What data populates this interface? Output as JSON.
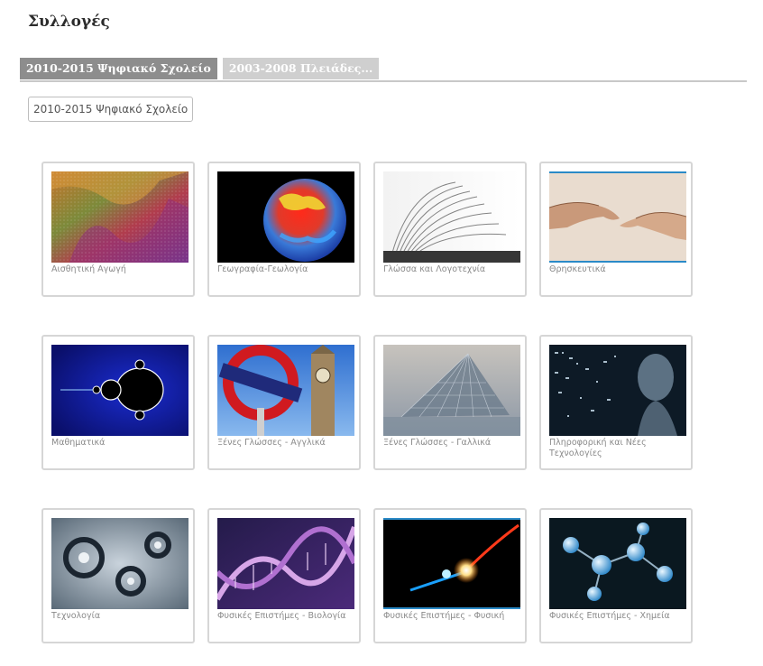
{
  "page": {
    "title": "Συλλογές"
  },
  "tabs": [
    {
      "label": "2010-2015 Ψηφιακό Σχολείο",
      "active": true
    },
    {
      "label": "2003-2008 Πλειάδες...",
      "active": false
    }
  ],
  "sub_button": {
    "label": "2010-2015 Ψηφιακό Σχολείο"
  },
  "collections": [
    {
      "label": "Αισθητική Αγωγή",
      "thumbnail": "abstract-painting"
    },
    {
      "label": "Γεωγραφία-Γεωλογία",
      "thumbnail": "earth-globe"
    },
    {
      "label": "Γλώσσα και Λογοτεχνία",
      "thumbnail": "open-book"
    },
    {
      "label": "Θρησκευτικά",
      "thumbnail": "creation-hands"
    },
    {
      "label": "Μαθηματικά",
      "thumbnail": "mandelbrot-fractal"
    },
    {
      "label": "Ξένες Γλώσσες - Αγγλικά",
      "thumbnail": "underground-big-ben"
    },
    {
      "label": "Ξένες Γλώσσες - Γαλλικά",
      "thumbnail": "louvre-pyramid"
    },
    {
      "label": "Πληροφορική και Νέες Τεχνολογίες",
      "thumbnail": "digital-human"
    },
    {
      "label": "Τεχνολογία",
      "thumbnail": "gears"
    },
    {
      "label": "Φυσικές Επιστήμες - Βιολογία",
      "thumbnail": "dna-helix"
    },
    {
      "label": "Φυσικές Επιστήμες - Φυσική",
      "thumbnail": "light-particle"
    },
    {
      "label": "Φυσικές Επιστήμες - Χημεία",
      "thumbnail": "molecules"
    }
  ]
}
